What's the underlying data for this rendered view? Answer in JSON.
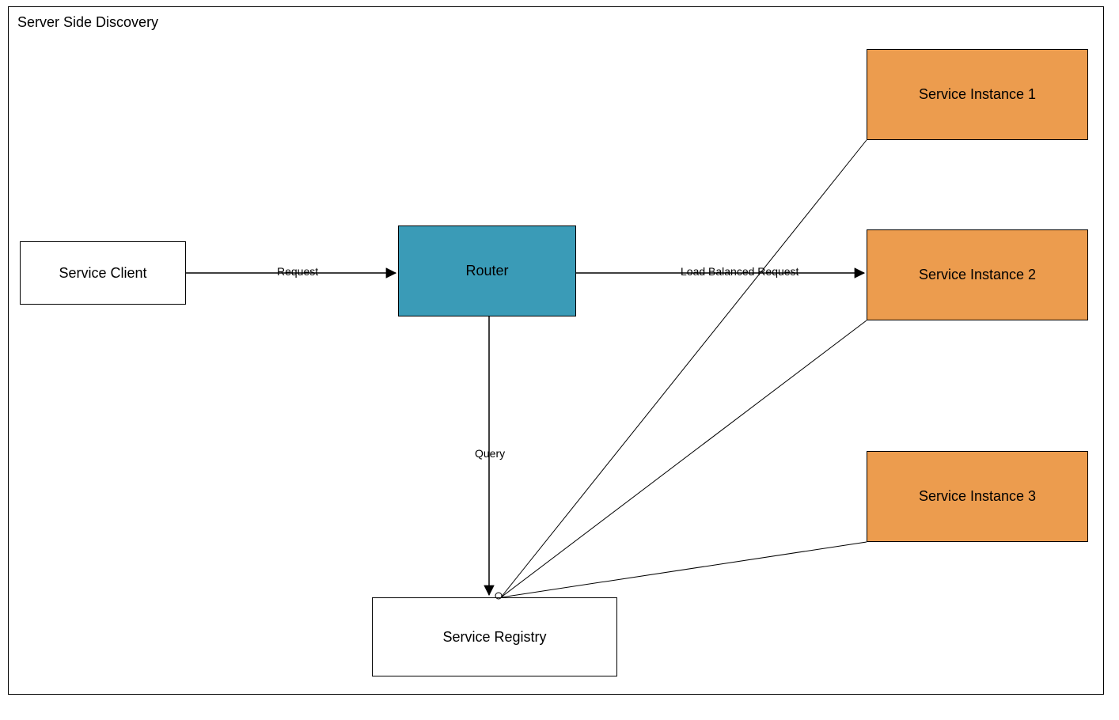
{
  "title": "Server Side Discovery",
  "nodes": {
    "client": {
      "label": "Service Client"
    },
    "router": {
      "label": "Router"
    },
    "instance1": {
      "label": "Service Instance 1"
    },
    "instance2": {
      "label": "Service Instance 2"
    },
    "instance3": {
      "label": "Service Instance 3"
    },
    "registry": {
      "label": "Service Registry"
    }
  },
  "edges": {
    "request": {
      "label": "Request"
    },
    "loadBalanced": {
      "label": "Load Balanced Request"
    },
    "query": {
      "label": "Query"
    }
  },
  "colors": {
    "router": "#3a9bb7",
    "instance": "#ec9c4e",
    "border": "#000000"
  }
}
